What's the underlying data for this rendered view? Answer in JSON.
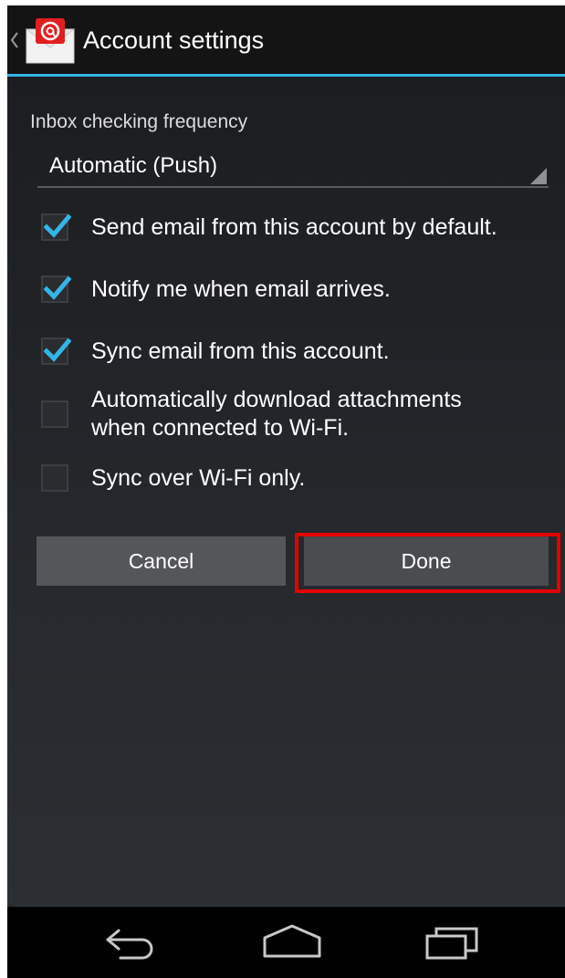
{
  "header": {
    "title": "Account settings",
    "app_icon": "email-app-icon",
    "back_icon": "back-caret-icon"
  },
  "settings": {
    "frequency_label": "Inbox checking frequency",
    "frequency_value": "Automatic (Push)",
    "options": [
      {
        "label": "Send email from this account by default.",
        "checked": true
      },
      {
        "label": "Notify me when email arrives.",
        "checked": true
      },
      {
        "label": "Sync email from this account.",
        "checked": true
      },
      {
        "label_line1": "Automatically download attachments",
        "label_line2": "when connected to Wi-Fi.",
        "checked": false
      },
      {
        "label": "Sync over Wi-Fi only.",
        "checked": false
      }
    ]
  },
  "buttons": {
    "cancel": "Cancel",
    "done": "Done"
  },
  "nav": {
    "back_icon": "back-arrow-icon",
    "home_icon": "home-icon",
    "recents_icon": "recent-apps-icon"
  },
  "colors": {
    "accent": "#33b5e5",
    "highlight": "#e30000"
  }
}
